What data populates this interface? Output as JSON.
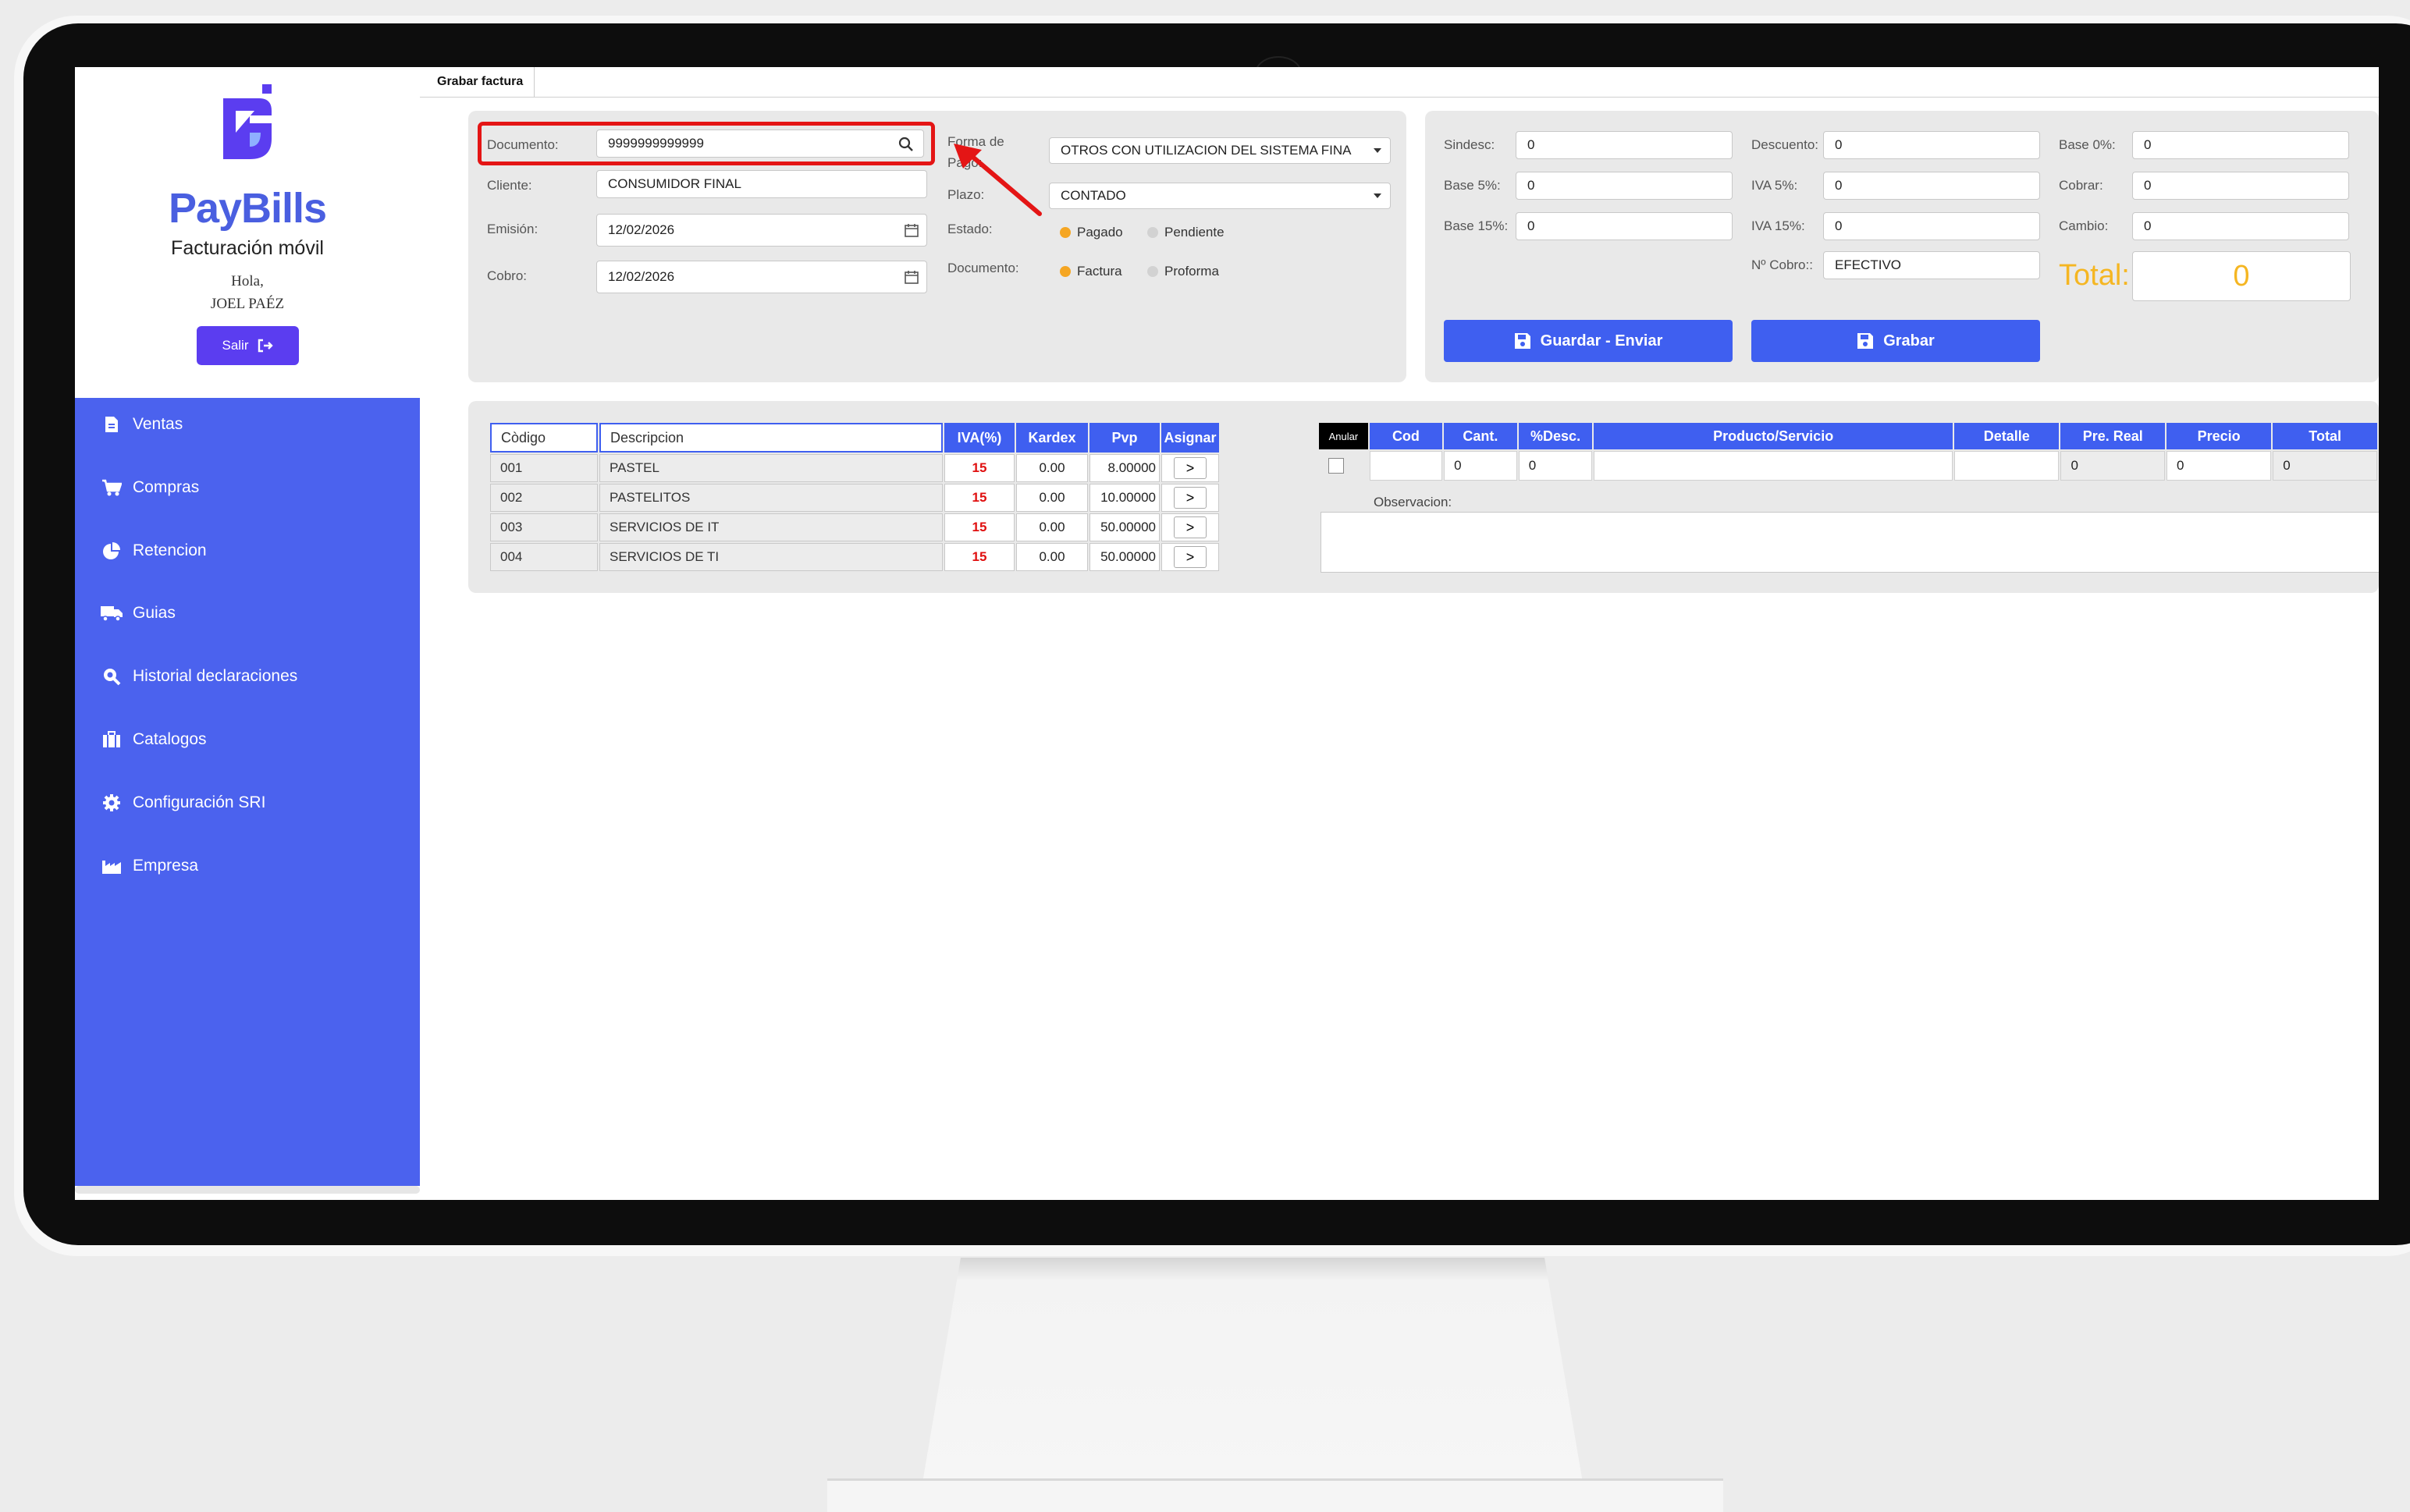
{
  "tab": {
    "label": "Grabar factura"
  },
  "brand": {
    "name": "PayBills",
    "subtitle": "Facturación móvil",
    "greeting": "Hola,",
    "user": "JOEL PAÉZ",
    "logout_label": "Salir"
  },
  "sidebar": {
    "items": [
      {
        "label": "Ventas",
        "icon": "document-icon"
      },
      {
        "label": "Compras",
        "icon": "cart-icon"
      },
      {
        "label": "Retencion",
        "icon": "pie-chart-icon"
      },
      {
        "label": "Guias",
        "icon": "truck-icon"
      },
      {
        "label": "Historial declaraciones",
        "icon": "search-icon"
      },
      {
        "label": "Catalogos",
        "icon": "briefcase-icon"
      },
      {
        "label": "Configuración SRI",
        "icon": "gear-icon"
      },
      {
        "label": "Empresa",
        "icon": "factory-icon"
      }
    ]
  },
  "form": {
    "documento_label": "Documento:",
    "documento_value": "9999999999999",
    "cliente_label": "Cliente:",
    "cliente_value": "CONSUMIDOR FINAL",
    "emision_label": "Emisión:",
    "emision_value": "12/02/2026",
    "cobro_label": "Cobro:",
    "cobro_value": "12/02/2026",
    "forma_pago_label": "Forma de Pago:",
    "forma_pago_value": "OTROS CON UTILIZACION DEL SISTEMA FINA",
    "plazo_label": "Plazo:",
    "plazo_value": "CONTADO",
    "estado_label": "Estado:",
    "estado_options": [
      "Pagado",
      "Pendiente"
    ],
    "estado_selected": "Pagado",
    "tipo_doc_label": "Documento:",
    "tipo_doc_options": [
      "Factura",
      "Proforma"
    ],
    "tipo_doc_selected": "Factura"
  },
  "totals": {
    "sindesc_label": "Sindesc:",
    "sindesc": "0",
    "descuento_label": "Descuento:",
    "descuento": "0",
    "base0_label": "Base 0%:",
    "base0": "0",
    "base5_label": "Base 5%:",
    "base5": "0",
    "iva5_label": "IVA 5%:",
    "iva5": "0",
    "cobrar_label": "Cobrar:",
    "cobrar": "0",
    "base15_label": "Base 15%:",
    "base15": "0",
    "iva15_label": "IVA 15%:",
    "iva15": "0",
    "cambio_label": "Cambio:",
    "cambio": "0",
    "ncobro_label": "Nº Cobro::",
    "ncobro": "EFECTIVO",
    "total_label": "Total:",
    "total": "0",
    "guardar_enviar_label": "Guardar - Enviar",
    "grabar_label": "Grabar"
  },
  "products": {
    "search_codigo_placeholder": "Còdigo",
    "search_descripcion_placeholder": "Descripcion",
    "headers": [
      "IVA(%)",
      "Kardex",
      "Pvp",
      "Asignar"
    ],
    "rows": [
      {
        "codigo": "001",
        "descripcion": "PASTEL",
        "iva": "15",
        "kardex": "0.00",
        "pvp": "8.00000"
      },
      {
        "codigo": "002",
        "descripcion": "PASTELITOS",
        "iva": "15",
        "kardex": "0.00",
        "pvp": "10.00000"
      },
      {
        "codigo": "003",
        "descripcion": "SERVICIOS DE IT",
        "iva": "15",
        "kardex": "0.00",
        "pvp": "50.00000"
      },
      {
        "codigo": "004",
        "descripcion": "SERVICIOS DE TI",
        "iva": "15",
        "kardex": "0.00",
        "pvp": "50.00000"
      }
    ],
    "assign_symbol": ">"
  },
  "detail": {
    "headers": [
      "Anular",
      "Cod",
      "Cant.",
      "%Desc.",
      "Producto/Servicio",
      "Detalle",
      "Pre. Real",
      "Precio",
      "Total"
    ],
    "row": {
      "cod": "",
      "cant": "0",
      "desc": "0",
      "producto": "",
      "detalle": "",
      "pre_real": "0",
      "precio": "0",
      "total": "0"
    },
    "observacion_label": "Observacion:"
  }
}
